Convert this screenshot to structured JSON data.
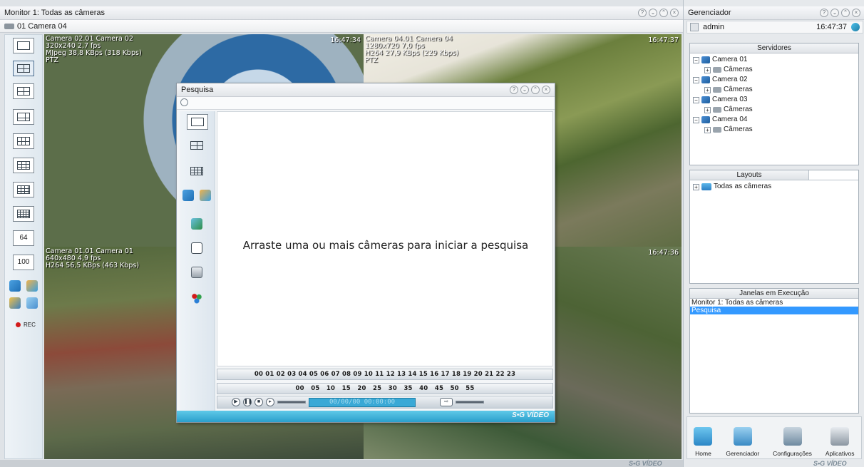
{
  "monitor": {
    "title": "Monitor 1: Todas as câmeras",
    "camera_selector": "01 Camera 04",
    "tools": [
      "64",
      "100"
    ],
    "rec_label": "REC",
    "logo": "S•G VÍDEO"
  },
  "cameras": [
    {
      "id": "cam2",
      "overlay": "Camera 02.01 Camera 02\n320x240 2,7 fps\nMJpeg 38,8 KBps (318 Kbps)\nPTZ",
      "time": "16:47:34"
    },
    {
      "id": "cam4",
      "overlay": "Camera 04.01 Camera 04\n1280x720 7,0 fps\nH264 27,9 KBps (229 Kbps)\nPTZ",
      "time": "16:47:37"
    },
    {
      "id": "cam1",
      "overlay": "Camera 01.01 Camera 01\n640x480 4,9 fps\nH264 56,5 KBps (463 Kbps)",
      "time": ""
    },
    {
      "id": "cam3",
      "overlay": "",
      "time": "16:47:36"
    }
  ],
  "search": {
    "title": "Pesquisa",
    "message": "Arraste uma ou mais câmeras para iniciar a pesquisa",
    "hours": "00 01 02 03 04 05 06 07 08 09 10 11 12 13 14 15 16 17 18 19 20 21 22 23",
    "minutes": "00   05   10   15   20   25   30   35   40   45   50   55",
    "date": "00/00/00  00:00:00",
    "logo": "S•G VÍDEO"
  },
  "manager": {
    "title": "Gerenciador",
    "user": "admin",
    "time": "16:47:37",
    "servers_header": "Servidores",
    "servers": [
      {
        "name": "Camera 01",
        "child": "Câmeras"
      },
      {
        "name": "Camera 02",
        "child": "Câmeras"
      },
      {
        "name": "Camera 03",
        "child": "Câmeras"
      },
      {
        "name": "Camera 04",
        "child": "Câmeras"
      }
    ],
    "layouts_header": "Layouts",
    "layouts": [
      "Todas as câmeras"
    ],
    "running_header": "Janelas em Execução",
    "running": [
      "Monitor 1: Todas as câmeras",
      "Pesquisa"
    ],
    "nav": [
      "Home",
      "Gerenciador",
      "Configurações",
      "Aplicativos"
    ],
    "logo": "S•G VÍDEO"
  },
  "colors": {
    "selection": "#3399ff",
    "accent": "#2a9fcc",
    "rec": "#d21b1b"
  }
}
